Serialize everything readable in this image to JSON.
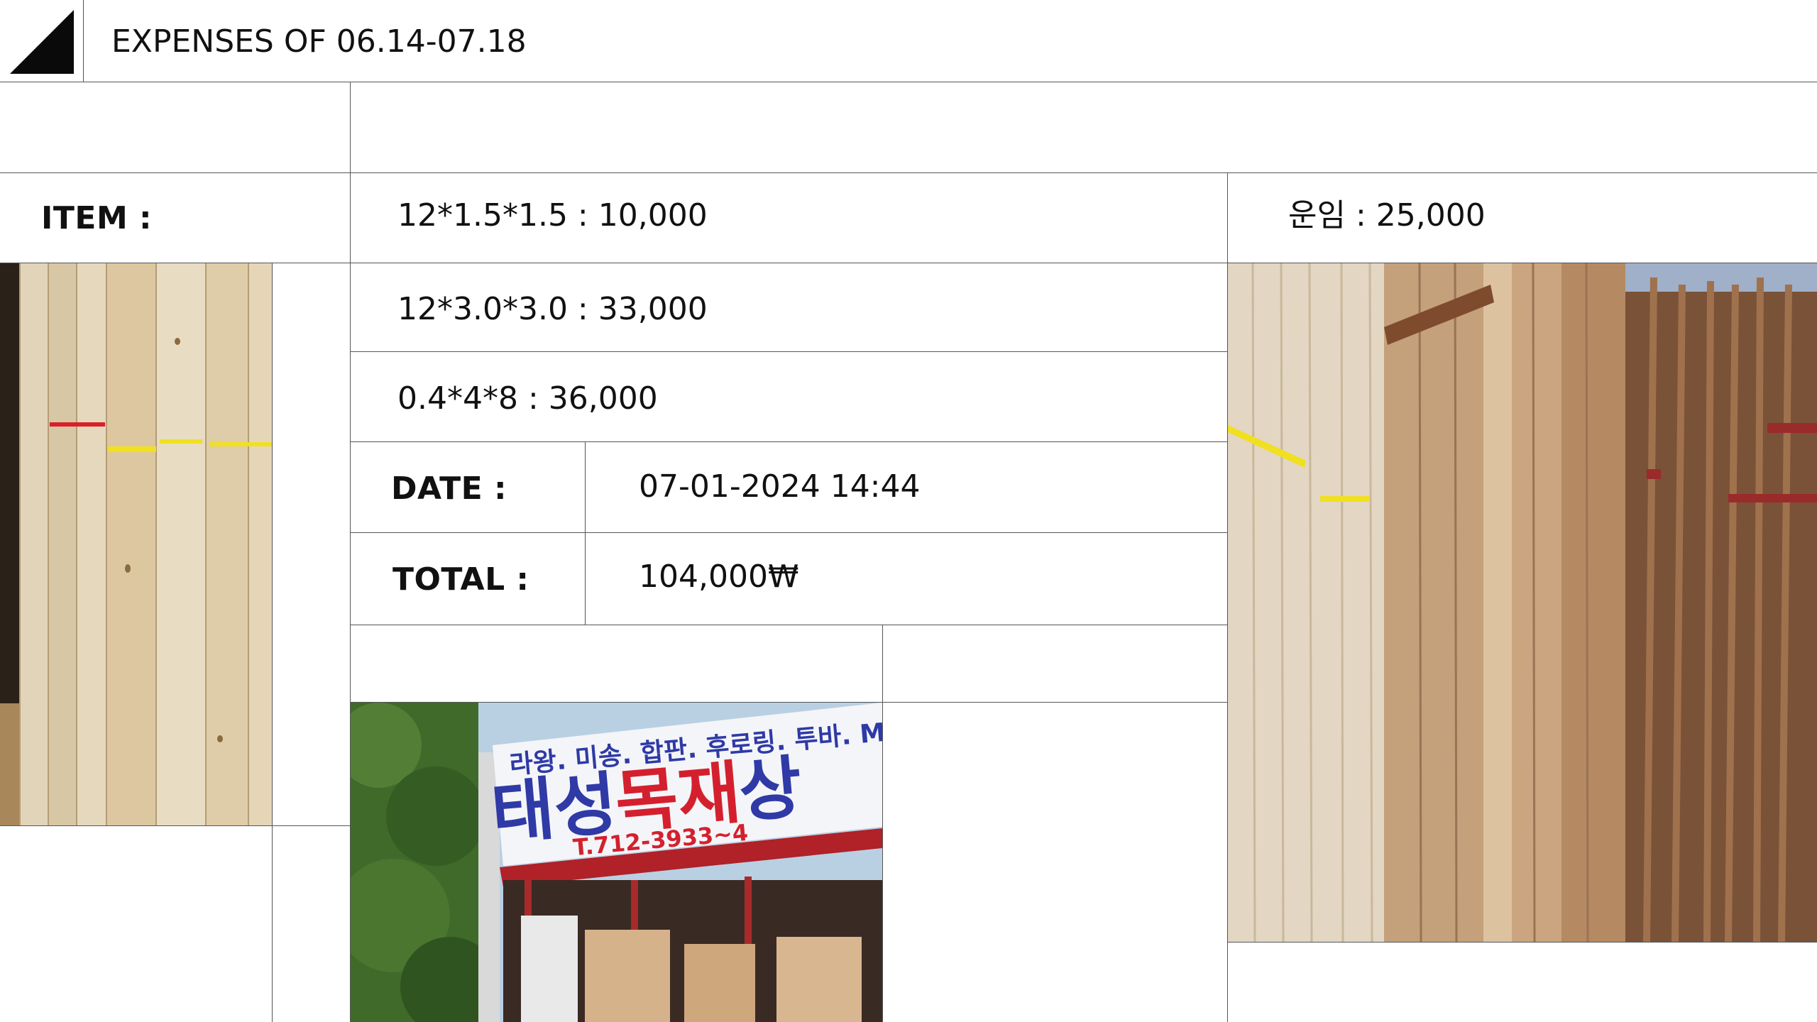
{
  "header": {
    "title": "EXPENSES OF 06.14-07.18"
  },
  "items": {
    "label": "ITEM :",
    "rows": [
      "12*1.5*1.5 : 10,000",
      "12*3.0*3.0 : 33,000",
      "0.4*4*8 : 36,000"
    ],
    "shipping": "운임 : 25,000"
  },
  "date": {
    "label": "DATE :",
    "value": "07-01-2024 14:44"
  },
  "total": {
    "label": "TOTAL :",
    "value": "104,000₩"
  },
  "storefront_sign": {
    "top_line": "라왕. 미송. 합판. 후로링. 투바. M",
    "name_part1": "태성",
    "name_part2": "목재",
    "name_part3": "상",
    "phone": "T.712-3933~4"
  },
  "colors": {
    "lines": "#555555",
    "sign_blue": "#2f3aa6",
    "sign_red": "#d4202e",
    "wood_light": "#e3d3b4"
  }
}
